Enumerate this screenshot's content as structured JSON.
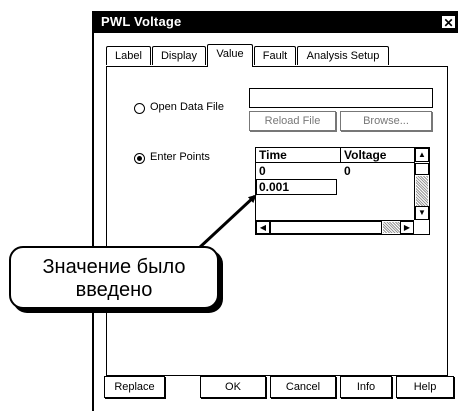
{
  "window": {
    "title": "PWL Voltage",
    "close_glyph": "✕"
  },
  "tabs": [
    {
      "label": "Label",
      "active": false
    },
    {
      "label": "Display",
      "active": false
    },
    {
      "label": "Value",
      "active": true
    },
    {
      "label": "Fault",
      "active": false
    },
    {
      "label": "Analysis Setup",
      "active": false
    }
  ],
  "source": {
    "open_file_label": "Open Data File",
    "open_file_selected": false,
    "file_path_value": "",
    "reload_label": "Reload File",
    "browse_label": "Browse...",
    "enter_points_label": "Enter Points",
    "enter_points_selected": true
  },
  "points_grid": {
    "columns": [
      "Time",
      "Voltage"
    ],
    "rows": [
      {
        "time": "0",
        "voltage": "0"
      }
    ],
    "editing_value": "0.001"
  },
  "footer": {
    "replace_label": "Replace",
    "ok_label": "OK",
    "cancel_label": "Cancel",
    "info_label": "Info",
    "help_label": "Help"
  },
  "callout": {
    "text": "Значение было введено"
  }
}
